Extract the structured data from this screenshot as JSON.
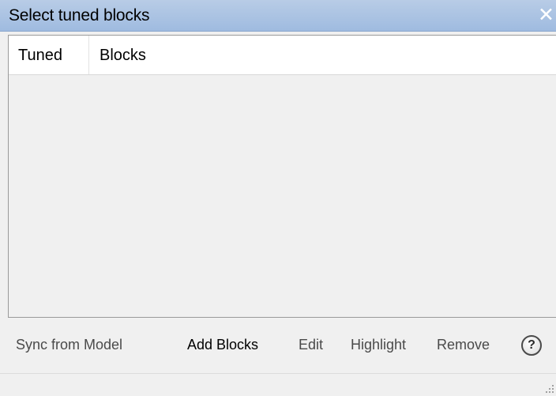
{
  "window": {
    "title": "Select tuned blocks",
    "close_icon": "close-icon"
  },
  "table": {
    "columns": [
      "Tuned",
      "Blocks"
    ],
    "rows": []
  },
  "toolbar": {
    "sync_label": "Sync from Model",
    "add_label": "Add Blocks",
    "edit_label": "Edit",
    "highlight_label": "Highlight",
    "remove_label": "Remove",
    "help_icon": "help-icon",
    "help_glyph": "?"
  },
  "statusbar": {
    "grip_icon": "resize-grip-icon"
  }
}
